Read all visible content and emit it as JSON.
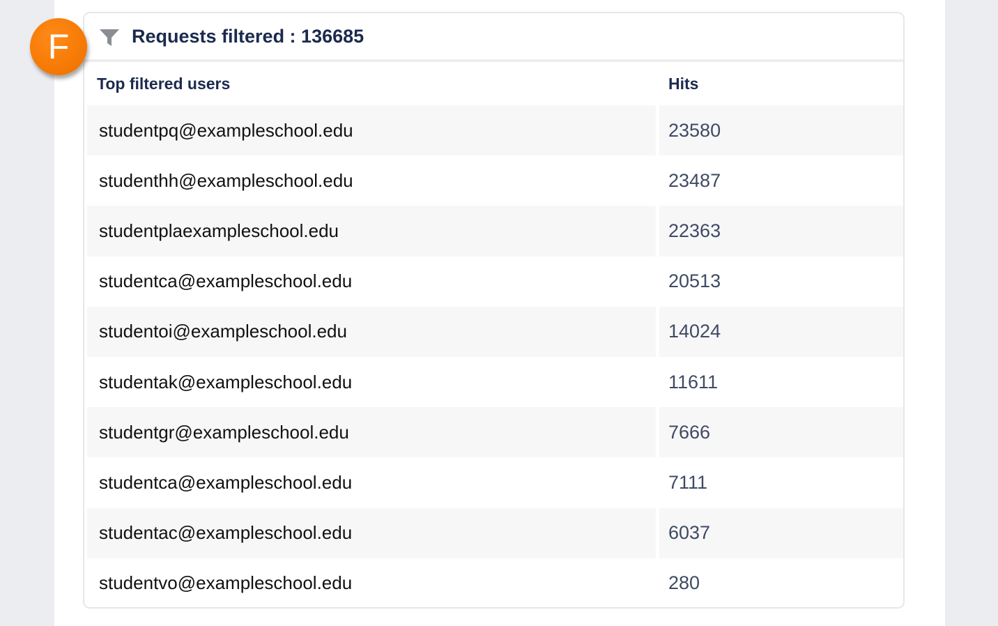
{
  "badge": {
    "letter": "F",
    "color": "#f67a05"
  },
  "card": {
    "title": "Requests filtered : 136685",
    "icon": "filter-icon"
  },
  "table": {
    "headers": {
      "users": "Top filtered users",
      "hits": "Hits"
    },
    "rows": [
      {
        "user": "studentpq@exampleschool.edu",
        "hits": "23580"
      },
      {
        "user": "studenthh@exampleschool.edu",
        "hits": "23487"
      },
      {
        "user": "studentplaexampleschool.edu",
        "hits": "22363"
      },
      {
        "user": "studentca@exampleschool.edu",
        "hits": "20513"
      },
      {
        "user": "studentoi@exampleschool.edu",
        "hits": "14024"
      },
      {
        "user": "studentak@exampleschool.edu",
        "hits": "11611"
      },
      {
        "user": "studentgr@exampleschool.edu",
        "hits": "7666"
      },
      {
        "user": "studentca@exampleschool.edu",
        "hits": "7111"
      },
      {
        "user": "studentac@exampleschool.edu",
        "hits": "6037"
      },
      {
        "user": "studentvo@exampleschool.edu",
        "hits": "280"
      }
    ]
  },
  "colors": {
    "title": "#1b2a4e",
    "hits_text": "#3f4a63",
    "row_shade": "#f7f7f8",
    "page_bg": "#ebedf1"
  }
}
